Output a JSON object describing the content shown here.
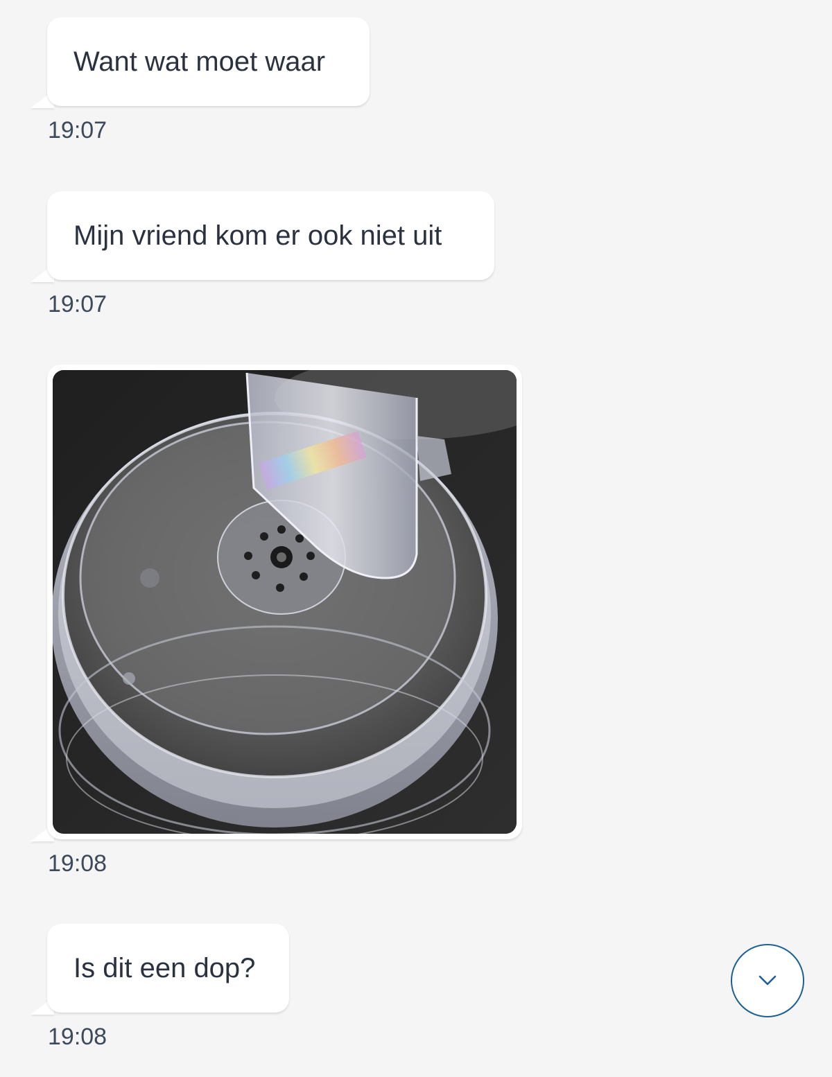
{
  "messages": [
    {
      "text": "Want wat moet waar",
      "time": "19:07"
    },
    {
      "text": "Mijn vriend kom er ook niet uit",
      "time": "19:07"
    },
    {
      "image": "photo-food-processor-lid",
      "time": "19:08"
    },
    {
      "text": "Is dit een dop?",
      "time": "19:08"
    }
  ],
  "scroll_button": {
    "icon": "chevron-down-icon"
  },
  "colors": {
    "background": "#f5f5f5",
    "bubble": "#ffffff",
    "text": "#2a3240",
    "timestamp": "#3c4a5c",
    "accent": "#1c5f93"
  }
}
